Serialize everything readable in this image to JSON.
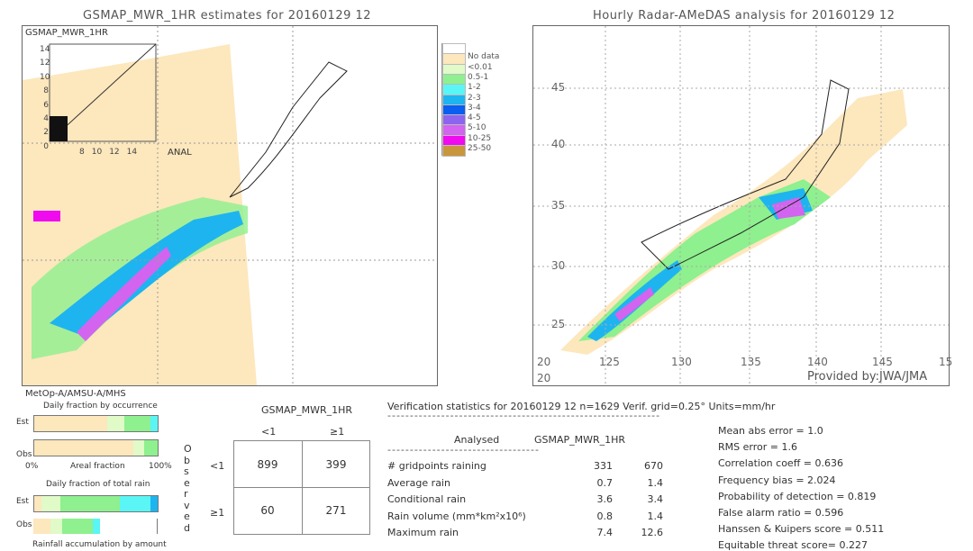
{
  "left_map": {
    "title": "GSMAP_MWR_1HR estimates for 20160129 12",
    "inset_ylabel": "GSMAP_MWR_1HR",
    "inset_xlabel": "ANAL",
    "inset_ticks": [
      "0",
      "2",
      "4",
      "6",
      "8",
      "10",
      "12",
      "14"
    ]
  },
  "right_map": {
    "title": "Hourly Radar-AMeDAS analysis for 20160129 12",
    "lon_ticks": [
      "20",
      "125",
      "130",
      "135",
      "140",
      "145",
      "15"
    ],
    "lat_ticks": [
      "45",
      "40",
      "35",
      "30",
      "25",
      "20"
    ],
    "credit": "Provided by:JWA/JMA"
  },
  "legend": {
    "items": [
      {
        "label": "",
        "color": "#ffffff"
      },
      {
        "label": "No data",
        "color": "#fde7bd"
      },
      {
        "label": "<0.01",
        "color": "#e0fac8"
      },
      {
        "label": "0.5-1",
        "color": "#8ef08e"
      },
      {
        "label": "1-2",
        "color": "#5af5f5"
      },
      {
        "label": "2-3",
        "color": "#1eb4f0"
      },
      {
        "label": "3-4",
        "color": "#0a5ef0"
      },
      {
        "label": "4-5",
        "color": "#8c64f0"
      },
      {
        "label": "5-10",
        "color": "#d264f0"
      },
      {
        "label": "10-25",
        "color": "#f00af0"
      },
      {
        "label": "25-50",
        "color": "#c8963c"
      }
    ]
  },
  "satellite": "MetOp-A/AMSU-A/MHS",
  "occurrence": {
    "title": "Daily fraction by occurrence",
    "est_label": "Est",
    "obs_label": "Obs",
    "axis_left": "0%",
    "axis_mid": "Areal fraction",
    "axis_right": "100%",
    "est": [
      {
        "color": "#fde7bd",
        "frac": 0.59
      },
      {
        "color": "#e0fac8",
        "frac": 0.14
      },
      {
        "color": "#8ef08e",
        "frac": 0.21
      },
      {
        "color": "#5af5f5",
        "frac": 0.06
      }
    ],
    "obs": [
      {
        "color": "#fde7bd",
        "frac": 0.8
      },
      {
        "color": "#e0fac8",
        "frac": 0.09
      },
      {
        "color": "#8ef08e",
        "frac": 0.11
      }
    ]
  },
  "total_rain": {
    "title": "Daily fraction of total rain",
    "est_label": "Est",
    "obs_label": "Obs",
    "footer": "Rainfall accumulation by amount",
    "est": [
      {
        "color": "#fde7bd",
        "frac": 0.06
      },
      {
        "color": "#e0fac8",
        "frac": 0.15
      },
      {
        "color": "#8ef08e",
        "frac": 0.48
      },
      {
        "color": "#5af5f5",
        "frac": 0.25
      },
      {
        "color": "#1eb4f0",
        "frac": 0.06
      }
    ],
    "obs": [
      {
        "color": "#fde7bd",
        "frac": 0.14
      },
      {
        "color": "#e0fac8",
        "frac": 0.09
      },
      {
        "color": "#8ef08e",
        "frac": 0.25
      },
      {
        "color": "#5af5f5",
        "frac": 0.06
      }
    ]
  },
  "contingency": {
    "title": "GSMAP_MWR_1HR",
    "col_labels": [
      "<1",
      "≥1"
    ],
    "row_labels": [
      "<1",
      "≥1"
    ],
    "side_label": "Observed",
    "values": [
      [
        "899",
        "399"
      ],
      [
        "60",
        "271"
      ]
    ]
  },
  "stats": {
    "header": "Verification statistics for 20160129 12   n=1629   Verif. grid=0.25°   Units=mm/hr",
    "col_analysed": "Analysed",
    "col_gsmap": "GSMAP_MWR_1HR",
    "rows": [
      {
        "label": "# gridpoints raining",
        "a": "331",
        "g": "670"
      },
      {
        "label": "Average rain",
        "a": "0.7",
        "g": "1.4"
      },
      {
        "label": "Conditional rain",
        "a": "3.6",
        "g": "3.4"
      },
      {
        "label": "Rain volume (mm*km²x10⁶)",
        "a": "0.8",
        "g": "1.4"
      },
      {
        "label": "Maximum rain",
        "a": "7.4",
        "g": "12.6"
      }
    ],
    "scores": [
      "Mean abs error = 1.0",
      "RMS error = 1.6",
      "Correlation coeff = 0.636",
      "Frequency bias = 2.024",
      "Probability of detection = 0.819",
      "False alarm ratio = 0.596",
      "Hanssen & Kuipers score = 0.511",
      "Equitable threat score= 0.227"
    ]
  }
}
